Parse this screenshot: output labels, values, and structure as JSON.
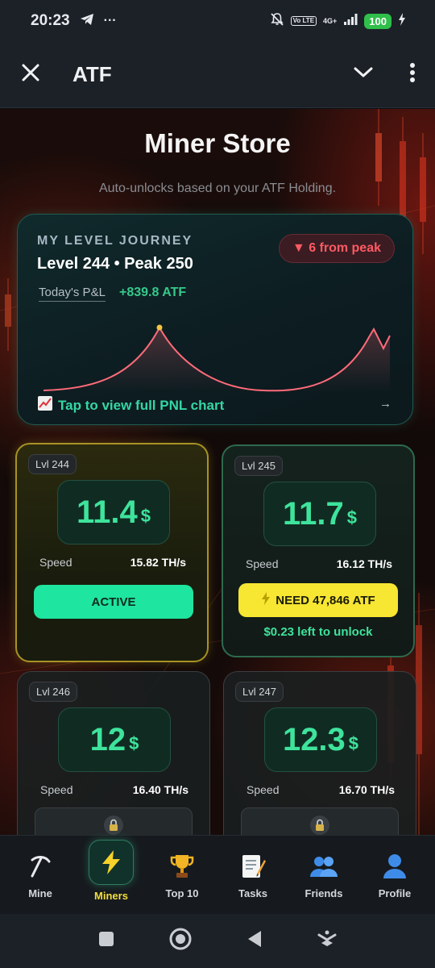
{
  "status_bar": {
    "time": "20:23",
    "battery": "100",
    "volte": "Vo LTE",
    "network": "4G+"
  },
  "header": {
    "title": "ATF"
  },
  "store": {
    "title": "Miner Store",
    "subtitle": "Auto-unlocks based on your ATF Holding."
  },
  "journey": {
    "label": "MY LEVEL JOURNEY",
    "level_text": "Level 244 • Peak 250",
    "peak_badge": "▼ 6 from peak",
    "pnl_label": "Today's P&L",
    "pnl_value": "+839.8 ATF",
    "link_text": "Tap to view full PNL chart",
    "arrow": "→"
  },
  "miners": [
    {
      "level": "Lvl 244",
      "price": "11.4",
      "unit": "$",
      "speed_label": "Speed",
      "speed": "15.82 TH/s",
      "action": "ACTIVE"
    },
    {
      "level": "Lvl 245",
      "price": "11.7",
      "unit": "$",
      "speed_label": "Speed",
      "speed": "16.12 TH/s",
      "action": "NEED 47,846 ATF",
      "unlock_text": "$0.23 left to unlock"
    },
    {
      "level": "Lvl 246",
      "price": "12",
      "unit": "$",
      "speed_label": "Speed",
      "speed": "16.40 TH/s"
    },
    {
      "level": "Lvl 247",
      "price": "12.3",
      "unit": "$",
      "speed_label": "Speed",
      "speed": "16.70 TH/s"
    }
  ],
  "nav": [
    {
      "label": "Mine",
      "icon": "pickaxe-icon"
    },
    {
      "label": "Miners",
      "icon": "lightning-icon",
      "active": true
    },
    {
      "label": "Top 10",
      "icon": "trophy-icon"
    },
    {
      "label": "Tasks",
      "icon": "memo-icon"
    },
    {
      "label": "Friends",
      "icon": "users-icon"
    },
    {
      "label": "Profile",
      "icon": "user-icon"
    }
  ],
  "colors": {
    "accent_green": "#3ee39c",
    "active_button": "#1ee5a0",
    "need_button": "#f7e632",
    "peak_red": "#ff5a63",
    "nav_active": "#f2df3b"
  }
}
